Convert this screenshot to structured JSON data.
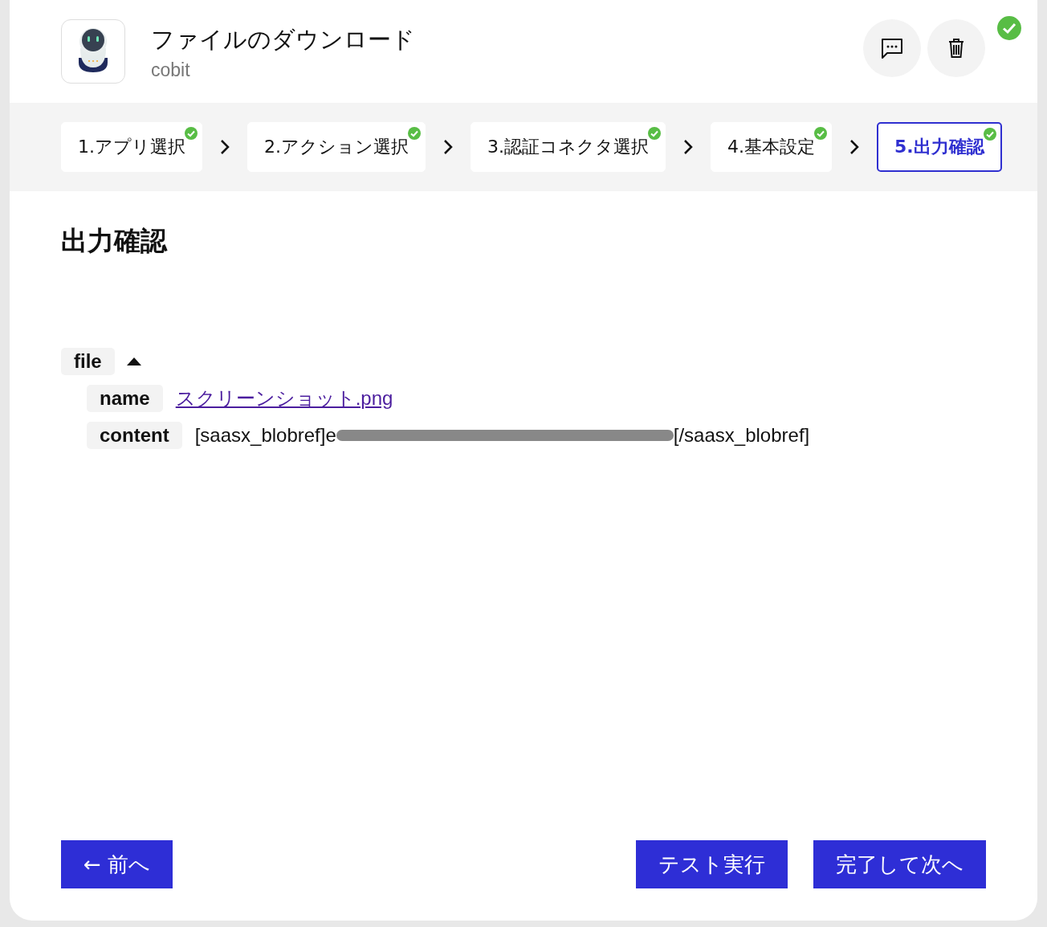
{
  "header": {
    "title": "ファイルのダウンロード",
    "subtitle": "cobit",
    "completed": true
  },
  "steps": [
    {
      "label": "1.アプリ選択",
      "completed": true,
      "selected": false
    },
    {
      "label": "2.アクション選択",
      "completed": true,
      "selected": false
    },
    {
      "label": "3.認証コネクタ選択",
      "completed": true,
      "selected": false
    },
    {
      "label": "4.基本設定",
      "completed": true,
      "selected": false
    },
    {
      "label": "5.出力確認",
      "completed": true,
      "selected": true
    }
  ],
  "section_title": "出力確認",
  "output": {
    "key": "file",
    "expanded": true,
    "children": [
      {
        "key": "name",
        "kind": "link",
        "value": "スクリーンショット.png"
      },
      {
        "key": "content",
        "kind": "redacted",
        "value_start": "[saasx_blobref]e",
        "value_end": "[/saasx_blobref]"
      }
    ]
  },
  "buttons": {
    "back": "← 前へ",
    "test": "テスト実行",
    "next": "完了して次へ"
  }
}
